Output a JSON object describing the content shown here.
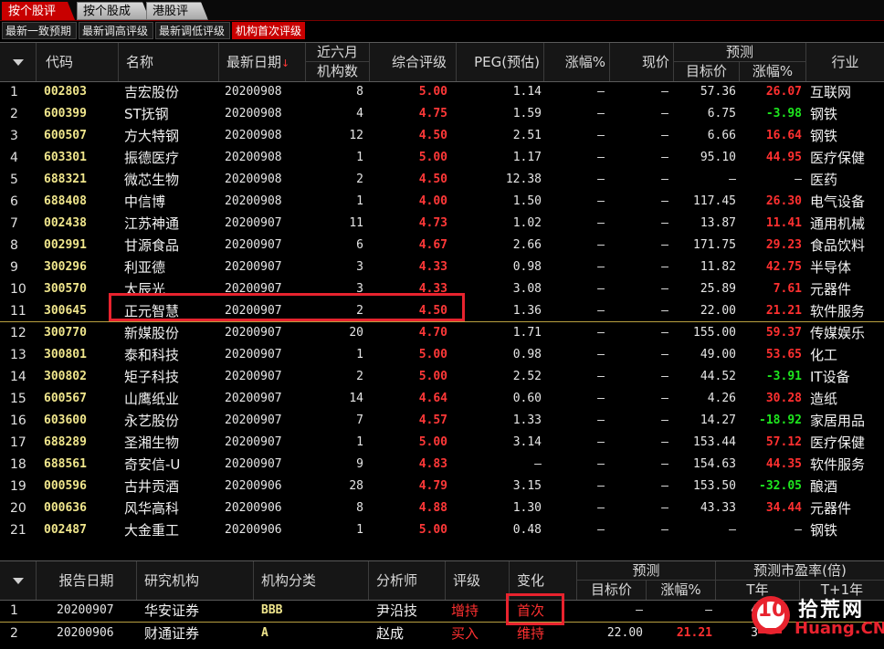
{
  "tabs_top": [
    {
      "label": "按个股评级",
      "active": true
    },
    {
      "label": "按个股成长",
      "active": false
    },
    {
      "label": "港股评级",
      "active": false
    }
  ],
  "tabs_sub": [
    {
      "label": "最新一致预期",
      "active": false
    },
    {
      "label": "最新调高评级",
      "active": false
    },
    {
      "label": "最新调低评级",
      "active": false
    },
    {
      "label": "机构首次评级",
      "active": true
    }
  ],
  "table": {
    "headers": {
      "code": "代码",
      "name": "名称",
      "date": "最新日期",
      "sort_arrow": "↓",
      "inst_top": "近六月",
      "inst_bottom": "机构数",
      "rating": "综合评级",
      "peg": "PEG(预估)",
      "change": "涨幅%",
      "price": "现价",
      "forecast_group": "预测",
      "target": "目标价",
      "fchange": "涨幅%",
      "industry": "行业"
    },
    "rows": [
      {
        "idx": "1",
        "code": "002803",
        "name": "吉宏股份",
        "date": "20200908",
        "inst": "8",
        "rating": "5.00",
        "peg": "1.14",
        "change": "–",
        "price": "–",
        "target": "57.36",
        "fchange": "26.07",
        "dir": "pos",
        "industry": "互联网"
      },
      {
        "idx": "2",
        "code": "600399",
        "name": "ST抚钢",
        "date": "20200908",
        "inst": "4",
        "rating": "4.75",
        "peg": "1.59",
        "change": "–",
        "price": "–",
        "target": "6.75",
        "fchange": "-3.98",
        "dir": "neg",
        "industry": "钢铁"
      },
      {
        "idx": "3",
        "code": "600507",
        "name": "方大特钢",
        "date": "20200908",
        "inst": "12",
        "rating": "4.50",
        "peg": "2.51",
        "change": "–",
        "price": "–",
        "target": "6.66",
        "fchange": "16.64",
        "dir": "pos",
        "industry": "钢铁"
      },
      {
        "idx": "4",
        "code": "603301",
        "name": "振德医疗",
        "date": "20200908",
        "inst": "1",
        "rating": "5.00",
        "peg": "1.17",
        "change": "–",
        "price": "–",
        "target": "95.10",
        "fchange": "44.95",
        "dir": "pos",
        "industry": "医疗保健"
      },
      {
        "idx": "5",
        "code": "688321",
        "name": "微芯生物",
        "date": "20200908",
        "inst": "2",
        "rating": "4.50",
        "peg": "12.38",
        "change": "–",
        "price": "–",
        "target": "–",
        "fchange": "–",
        "dir": "none",
        "industry": "医药"
      },
      {
        "idx": "6",
        "code": "688408",
        "name": "中信博",
        "date": "20200908",
        "inst": "1",
        "rating": "4.00",
        "peg": "1.50",
        "change": "–",
        "price": "–",
        "target": "117.45",
        "fchange": "26.30",
        "dir": "pos",
        "industry": "电气设备"
      },
      {
        "idx": "7",
        "code": "002438",
        "name": "江苏神通",
        "date": "20200907",
        "inst": "11",
        "rating": "4.73",
        "peg": "1.02",
        "change": "–",
        "price": "–",
        "target": "13.87",
        "fchange": "11.41",
        "dir": "pos",
        "industry": "通用机械"
      },
      {
        "idx": "8",
        "code": "002991",
        "name": "甘源食品",
        "date": "20200907",
        "inst": "6",
        "rating": "4.67",
        "peg": "2.66",
        "change": "–",
        "price": "–",
        "target": "171.75",
        "fchange": "29.23",
        "dir": "pos",
        "industry": "食品饮料"
      },
      {
        "idx": "9",
        "code": "300296",
        "name": "利亚德",
        "date": "20200907",
        "inst": "3",
        "rating": "4.33",
        "peg": "0.98",
        "change": "–",
        "price": "–",
        "target": "11.82",
        "fchange": "42.75",
        "dir": "pos",
        "industry": "半导体"
      },
      {
        "idx": "10",
        "code": "300570",
        "name": "太辰光",
        "date": "20200907",
        "inst": "3",
        "rating": "4.33",
        "peg": "3.08",
        "change": "–",
        "price": "–",
        "target": "25.89",
        "fchange": "7.61",
        "dir": "pos",
        "industry": "元器件"
      },
      {
        "idx": "11",
        "code": "300645",
        "name": "正元智慧",
        "date": "20200907",
        "inst": "2",
        "rating": "4.50",
        "peg": "1.36",
        "change": "–",
        "price": "–",
        "target": "22.00",
        "fchange": "21.21",
        "dir": "pos",
        "industry": "软件服务"
      },
      {
        "idx": "12",
        "code": "300770",
        "name": "新媒股份",
        "date": "20200907",
        "inst": "20",
        "rating": "4.70",
        "peg": "1.71",
        "change": "–",
        "price": "–",
        "target": "155.00",
        "fchange": "59.37",
        "dir": "pos",
        "industry": "传媒娱乐"
      },
      {
        "idx": "13",
        "code": "300801",
        "name": "泰和科技",
        "date": "20200907",
        "inst": "1",
        "rating": "5.00",
        "peg": "0.98",
        "change": "–",
        "price": "–",
        "target": "49.00",
        "fchange": "53.65",
        "dir": "pos",
        "industry": "化工"
      },
      {
        "idx": "14",
        "code": "300802",
        "name": "矩子科技",
        "date": "20200907",
        "inst": "2",
        "rating": "5.00",
        "peg": "2.52",
        "change": "–",
        "price": "–",
        "target": "44.52",
        "fchange": "-3.91",
        "dir": "neg",
        "industry": "IT设备"
      },
      {
        "idx": "15",
        "code": "600567",
        "name": "山鹰纸业",
        "date": "20200907",
        "inst": "14",
        "rating": "4.64",
        "peg": "0.60",
        "change": "–",
        "price": "–",
        "target": "4.26",
        "fchange": "30.28",
        "dir": "pos",
        "industry": "造纸"
      },
      {
        "idx": "16",
        "code": "603600",
        "name": "永艺股份",
        "date": "20200907",
        "inst": "7",
        "rating": "4.57",
        "peg": "1.33",
        "change": "–",
        "price": "–",
        "target": "14.27",
        "fchange": "-18.92",
        "dir": "neg",
        "industry": "家居用品"
      },
      {
        "idx": "17",
        "code": "688289",
        "name": "圣湘生物",
        "date": "20200907",
        "inst": "1",
        "rating": "5.00",
        "peg": "3.14",
        "change": "–",
        "price": "–",
        "target": "153.44",
        "fchange": "57.12",
        "dir": "pos",
        "industry": "医疗保健"
      },
      {
        "idx": "18",
        "code": "688561",
        "name": "奇安信-U",
        "date": "20200907",
        "inst": "9",
        "rating": "4.83",
        "peg": "–",
        "change": "–",
        "price": "–",
        "target": "154.63",
        "fchange": "44.35",
        "dir": "pos",
        "industry": "软件服务"
      },
      {
        "idx": "19",
        "code": "000596",
        "name": "古井贡酒",
        "date": "20200906",
        "inst": "28",
        "rating": "4.79",
        "peg": "3.15",
        "change": "–",
        "price": "–",
        "target": "153.50",
        "fchange": "-32.05",
        "dir": "neg",
        "industry": "酿酒"
      },
      {
        "idx": "20",
        "code": "000636",
        "name": "风华高科",
        "date": "20200906",
        "inst": "8",
        "rating": "4.88",
        "peg": "1.30",
        "change": "–",
        "price": "–",
        "target": "43.33",
        "fchange": "34.44",
        "dir": "pos",
        "industry": "元器件"
      },
      {
        "idx": "21",
        "code": "002487",
        "name": "大金重工",
        "date": "20200906",
        "inst": "1",
        "rating": "5.00",
        "peg": "0.48",
        "change": "–",
        "price": "–",
        "target": "–",
        "fchange": "–",
        "dir": "none",
        "industry": "钢铁"
      }
    ]
  },
  "detail": {
    "headers": {
      "report_date": "报告日期",
      "institution": "研究机构",
      "inst_class": "机构分类",
      "analyst": "分析师",
      "rating": "评级",
      "change": "变化",
      "forecast_group": "预测",
      "target": "目标价",
      "fchange": "涨幅%",
      "pe_group": "预测市盈率(倍)",
      "t_year": "T年",
      "t1_year": "T+1年"
    },
    "rows": [
      {
        "idx": "1",
        "date": "20200907",
        "institution": "华安证券",
        "class": "BBB",
        "analyst": "尹沿技",
        "rating": "增持",
        "change": "首次",
        "target": "–",
        "fchange": "–",
        "t": "4"
      },
      {
        "idx": "2",
        "date": "20200906",
        "institution": "财通证券",
        "class": "A",
        "analyst": "赵成",
        "rating": "买入",
        "change": "维持",
        "target": "22.00",
        "fchange": "21.21",
        "t": "3"
      }
    ]
  },
  "watermark": {
    "logo": "10",
    "name": "拾荒网",
    "site": "Huang.CN"
  },
  "colors": {
    "accent_red": "#c80000",
    "up": "#ff3030",
    "down": "#1ee61e",
    "code": "#f0e68c",
    "highlight_box": "#e8232e"
  }
}
